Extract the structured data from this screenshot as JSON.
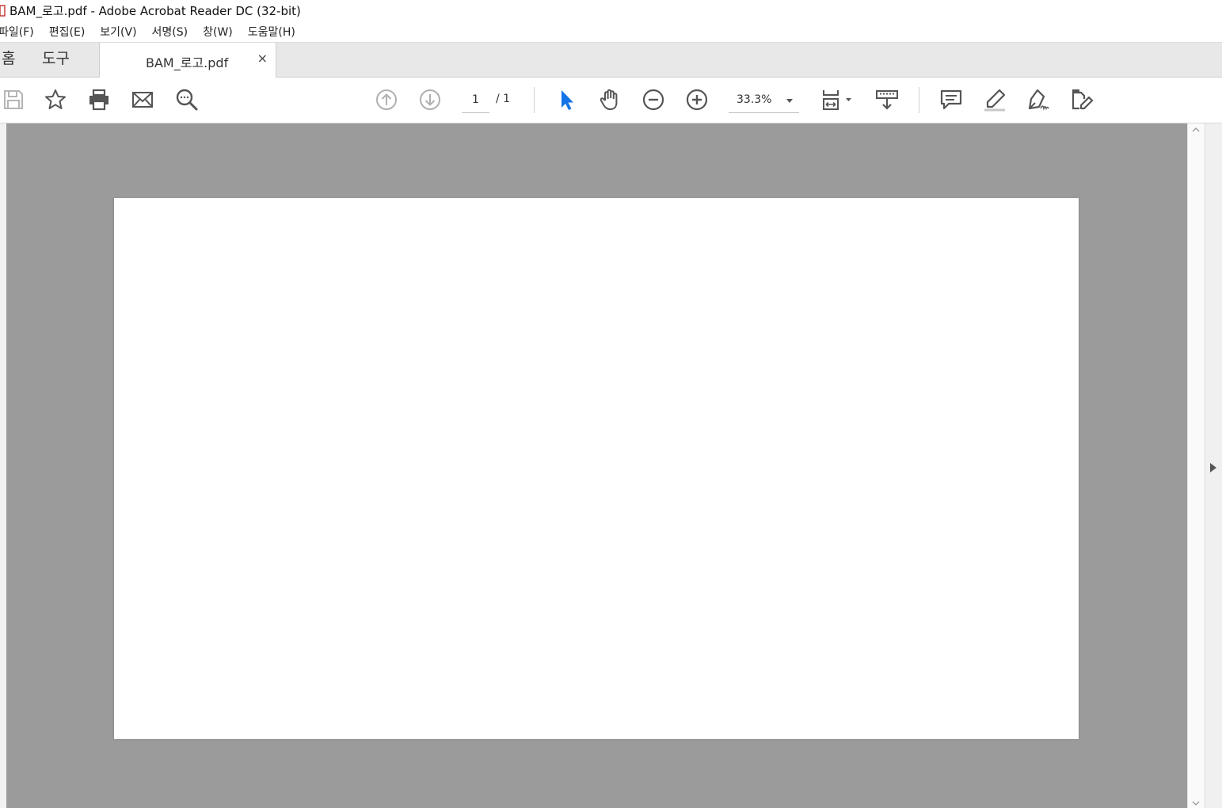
{
  "window": {
    "title": "BAM_로고.pdf - Adobe Acrobat Reader DC (32-bit)"
  },
  "menubar": {
    "items": [
      "파일(F)",
      "편집(E)",
      "보기(V)",
      "서명(S)",
      "창(W)",
      "도움말(H)"
    ]
  },
  "tabs": {
    "home": "홈",
    "tools": "도구",
    "document": "BAM_로고.pdf",
    "close": "×"
  },
  "toolbar": {
    "icons": [
      "save-icon",
      "bookmark-star-icon",
      "print-icon",
      "email-icon",
      "find-icon",
      "page-up-icon",
      "page-down-icon",
      "select-cursor-icon",
      "hand-icon",
      "zoom-out-icon",
      "zoom-in-icon",
      "fit-page-icon",
      "scroll-mode-icon",
      "comment-icon",
      "highlight-icon",
      "sign-icon",
      "edit-icon"
    ],
    "current_page": "1",
    "page_total": "/ 1",
    "zoom": "33.3%"
  },
  "colors": {
    "viewer_bg": "#9b9b9b",
    "accent_blue": "#1473e6",
    "icon_gray": "#555555"
  }
}
